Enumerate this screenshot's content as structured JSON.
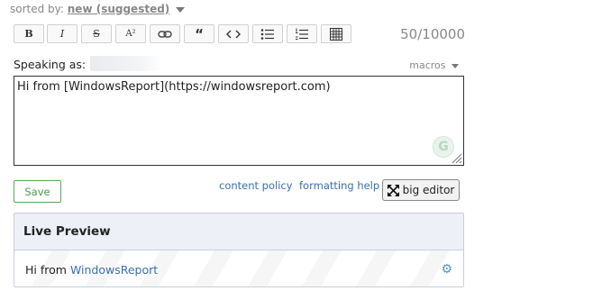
{
  "sort": {
    "label": "sorted by:",
    "value": "new (suggested)"
  },
  "toolbar": {
    "bold": "B",
    "italic": "I",
    "strike": "S",
    "superscript": "A²",
    "link": "⚭",
    "quote": "“",
    "code": "<>",
    "counter": "50/10000"
  },
  "speaking_as": {
    "label": "Speaking as:"
  },
  "macros": {
    "label": "macros"
  },
  "editor": {
    "value": "Hi from [WindowsReport](https://windowsreport.com)"
  },
  "grammarly": {
    "glyph": "G"
  },
  "actions": {
    "save": "Save",
    "content_policy": "content policy",
    "formatting_help": "formatting help",
    "big_editor": "big editor"
  },
  "preview": {
    "title": "Live Preview",
    "text_prefix": "Hi from",
    "link_text": "WindowsReport",
    "gear": "⚙"
  },
  "colors": {
    "save_green": "#4d9a4d",
    "link_blue": "#3a6fb0",
    "preview_header_bg": "#edf0f7"
  }
}
